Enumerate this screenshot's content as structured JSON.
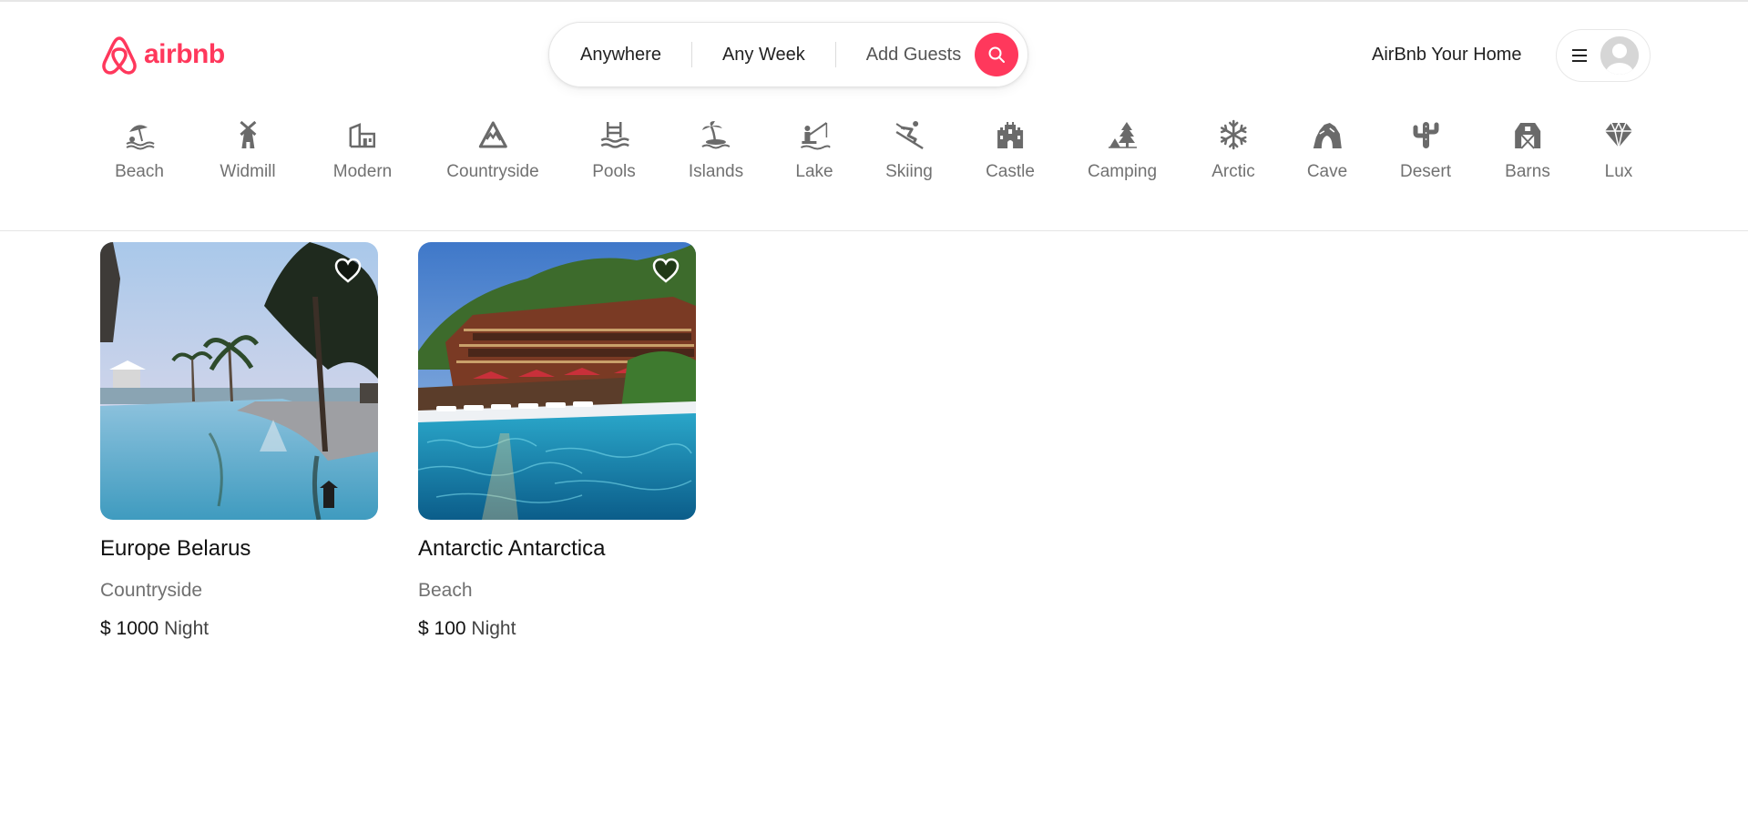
{
  "header": {
    "logo_text": "airbnb",
    "search": {
      "location": "Anywhere",
      "week": "Any Week",
      "guests": "Add Guests"
    },
    "host_link": "AirBnb Your Home"
  },
  "categories": [
    {
      "label": "Beach",
      "icon": "beach-umbrella-icon"
    },
    {
      "label": "Widmill",
      "icon": "windmill-icon"
    },
    {
      "label": "Modern",
      "icon": "modern-house-icon"
    },
    {
      "label": "Countryside",
      "icon": "mountain-icon"
    },
    {
      "label": "Pools",
      "icon": "pool-icon"
    },
    {
      "label": "Islands",
      "icon": "island-palm-icon"
    },
    {
      "label": "Lake",
      "icon": "fishing-icon"
    },
    {
      "label": "Skiing",
      "icon": "skier-icon"
    },
    {
      "label": "Castle",
      "icon": "castle-icon"
    },
    {
      "label": "Camping",
      "icon": "tent-tree-icon"
    },
    {
      "label": "Arctic",
      "icon": "snowflake-icon"
    },
    {
      "label": "Cave",
      "icon": "cave-icon"
    },
    {
      "label": "Desert",
      "icon": "cactus-icon"
    },
    {
      "label": "Barns",
      "icon": "barn-icon"
    },
    {
      "label": "Lux",
      "icon": "diamond-icon"
    }
  ],
  "listings": [
    {
      "title": "Europe Belarus",
      "category": "Countryside",
      "price": "$ 1000",
      "unit": "Night"
    },
    {
      "title": "Antarctic Antarctica",
      "category": "Beach",
      "price": "$ 100",
      "unit": "Night"
    }
  ],
  "colors": {
    "brand": "#ff385c",
    "muted_text": "#717171",
    "icon_gray": "#6a6a6a"
  }
}
